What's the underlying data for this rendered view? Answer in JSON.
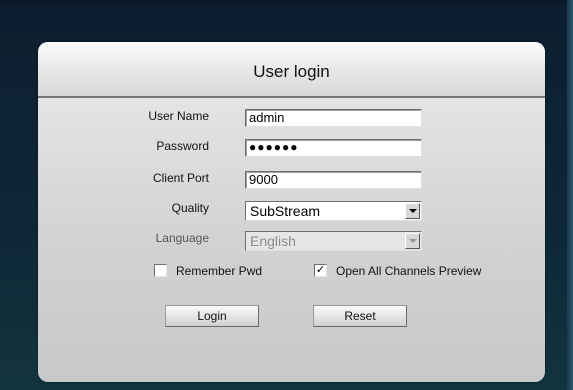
{
  "header": {
    "title": "User login"
  },
  "form": {
    "username": {
      "label": "User Name",
      "value": "admin"
    },
    "password": {
      "label": "Password",
      "value": "●●●●●●"
    },
    "client_port": {
      "label": "Client Port",
      "value": "9000"
    },
    "quality": {
      "label": "Quality",
      "value": "SubStream"
    },
    "language": {
      "label": "Language",
      "value": "English",
      "enabled": false
    }
  },
  "options": {
    "remember_pwd": {
      "label": "Remember Pwd",
      "checked": false,
      "mark": ""
    },
    "open_all_channels": {
      "label": "Open All Channels Preview",
      "checked": true,
      "mark": "✓"
    }
  },
  "buttons": {
    "login": "Login",
    "reset": "Reset"
  },
  "icons": {
    "dropdown": "chevron-down-icon",
    "check": "check-icon"
  }
}
